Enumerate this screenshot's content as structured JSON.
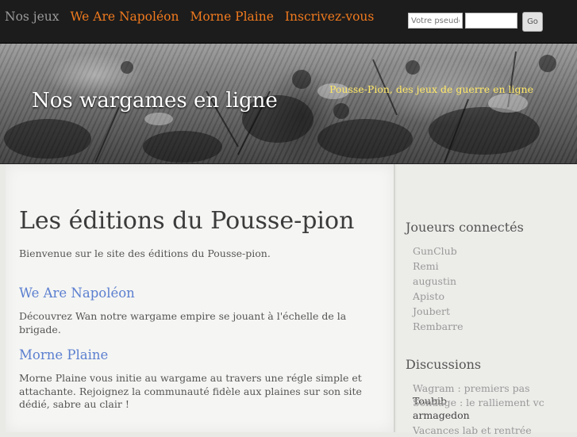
{
  "nav": {
    "items": [
      "Nos jeux",
      "We Are Napoléon",
      "Morne Plaine",
      "Inscrivez-vous"
    ],
    "colors": {
      "muted": "#9a9a9a",
      "accent": "#f07a1e"
    }
  },
  "login": {
    "username_placeholder": "Votre pseudo",
    "password_value": "",
    "go_label": "Go"
  },
  "banner": {
    "site_title": "Nos wargames en ligne",
    "tagline": "Pousse-Pion, des jeux de guerre en ligne"
  },
  "main": {
    "title": "Les éditions du Pousse-pion",
    "intro": "Bienvenue sur le site des éditions du Pousse-pion.",
    "sections": [
      {
        "heading": "We Are Napoléon",
        "text": "Découvrez Wan notre wargame empire se jouant à l'échelle de la brigade."
      },
      {
        "heading": "Morne Plaine",
        "text": "Morne Plaine vous initie au wargame au travers une régle simple et attachante. Rejoignez la communauté fidèle aux plaines sur son site dédié, sabre au clair !"
      }
    ]
  },
  "sidebar": {
    "players_heading": "Joueurs connectés",
    "players": [
      "GunClub",
      "Remi",
      "augustin",
      "Apisto",
      "Joubert",
      "Rembarre"
    ],
    "discussions_heading": "Discussions",
    "discussions": [
      {
        "topic": "Wagram : premiers pas",
        "author": "Toubib"
      },
      {
        "topic": "Sondage : le ralliement vc",
        "author": "armagedon"
      },
      {
        "topic": "Vacances lab et rentrée",
        "author": ""
      }
    ]
  }
}
